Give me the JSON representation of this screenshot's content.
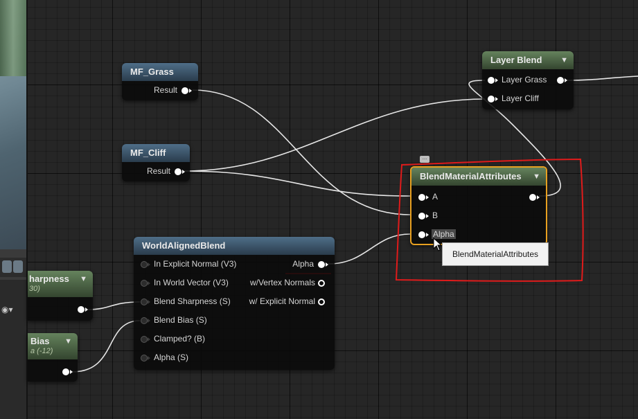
{
  "nodes": {
    "mf_grass": {
      "title": "MF_Grass",
      "output": "Result"
    },
    "mf_cliff": {
      "title": "MF_Cliff",
      "output": "Result"
    },
    "layer_blend": {
      "title": "Layer Blend",
      "inputs": [
        "Layer Grass",
        "Layer Cliff"
      ]
    },
    "blend_material_attributes": {
      "title": "BlendMaterialAttributes",
      "inputs": [
        "A",
        "B",
        "Alpha"
      ]
    },
    "world_aligned_blend": {
      "title": "WorldAlignedBlend",
      "inputs": [
        "In Explicit Normal (V3)",
        "In World Vector (V3)",
        "Blend Sharpness (S)",
        "Blend Bias (S)",
        "Clamped? (B)",
        "Alpha (S)"
      ],
      "outputs": [
        "Alpha",
        "w/Vertex Normals",
        "w/ Explicit Normal"
      ]
    },
    "sharpness_param": {
      "title": "harpness",
      "value": "30)"
    },
    "bias_param": {
      "title": "Bias",
      "value": "a (-12)"
    }
  },
  "tooltip": {
    "text": "BlendMaterialAttributes"
  },
  "colors": {
    "annotation": "#e01b1b",
    "node_blue": "#3d566b",
    "node_green": "#4d6646",
    "selection": "#e8a020"
  }
}
